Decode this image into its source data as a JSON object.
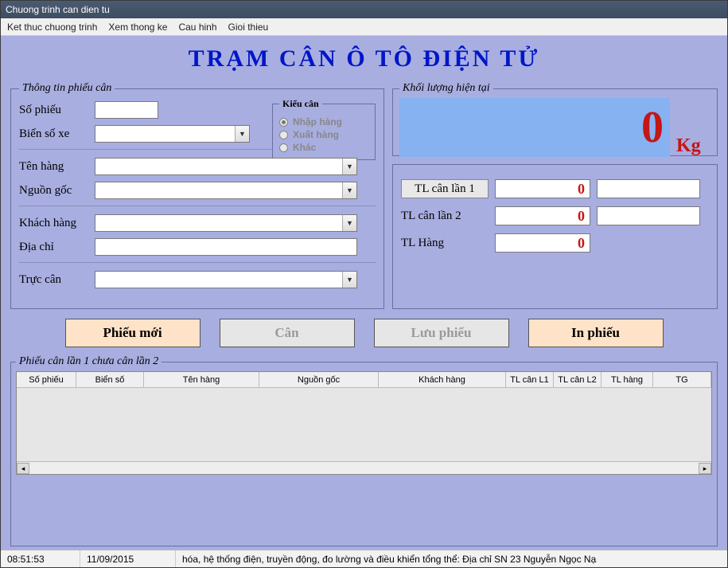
{
  "window_title": "Chuong trinh can dien tu",
  "menubar": {
    "exit": "Ket thuc chuong trinh",
    "stats": "Xem thong ke",
    "config": "Cau hinh",
    "about": "Gioi thieu"
  },
  "apptitle": "TRẠM CÂN Ô TÔ ĐIỆN TỬ",
  "sections": {
    "info_legend": "Thông tin phiếu cân",
    "kieucan_legend": "Kiểu cân",
    "weight_legend": "Khối lượng hiện tại",
    "grid_legend": "Phiếu cân lần 1 chưa cân lần 2"
  },
  "labels": {
    "so_phieu": "Số phiếu",
    "bien_so": "Biển số xe",
    "ten_hang": "Tên hàng",
    "nguon_goc": "Nguồn gốc",
    "khach_hang": "Khách hàng",
    "dia_chi": "Địa chỉ",
    "truc_can": "Trực cân",
    "tl_lan1": "TL cân lần 1",
    "tl_lan2": "TL cân lần 2",
    "tl_hang": "TL Hàng",
    "kg": "Kg"
  },
  "kieucan": {
    "nhap": "Nhập hàng",
    "xuat": "Xuất hàng",
    "khac": "Khác",
    "selected": "nhap"
  },
  "values": {
    "so_phieu": "",
    "bien_so": "",
    "ten_hang": "",
    "nguon_goc": "",
    "khach_hang": "",
    "dia_chi": "",
    "truc_can": "",
    "weight_current": "0",
    "tl1": "0",
    "tl1_extra": "",
    "tl2": "0",
    "tl2_extra": "",
    "tlh": "0"
  },
  "buttons": {
    "new": "Phiếu mới",
    "can": "Cân",
    "save": "Lưu phiếu",
    "print": "In phiếu"
  },
  "grid_columns": {
    "c1": "Số phiếu",
    "c2": "Biển số",
    "c3": "Tên hàng",
    "c4": "Nguồn gốc",
    "c5": "Khách hàng",
    "c6": "TL cân L1",
    "c7": "TL cân L2",
    "c8": "TL hàng",
    "c9": "TG"
  },
  "status": {
    "time": "08:51:53",
    "date": "11/09/2015",
    "msg": "hóa, hệ thống điện, truyền động, đo lường và điều khiển tổng thể: Địa chỉ SN 23 Nguyễn Ngọc Nạ"
  }
}
